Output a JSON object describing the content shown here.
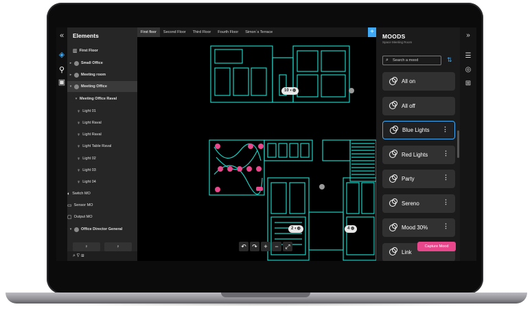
{
  "app": {
    "elements_title": "Elements",
    "collapse_left": "«",
    "collapse_right": "»",
    "floor_root": "First Floor"
  },
  "tree": [
    {
      "label": "Small Office",
      "kind": "room",
      "toggle": "▸"
    },
    {
      "label": "Meeting room",
      "kind": "room",
      "toggle": "▸"
    },
    {
      "label": "Meeting Office",
      "kind": "room",
      "toggle": "▾",
      "selected": true
    },
    {
      "label": "Meeting Office Raval",
      "kind": "group",
      "toggle": "▾"
    },
    {
      "label": "Light 01",
      "kind": "light"
    },
    {
      "label": "Light Raval",
      "kind": "light"
    },
    {
      "label": "Light Raval",
      "kind": "light"
    },
    {
      "label": "Light Table Raval",
      "kind": "light"
    },
    {
      "label": "Light 02",
      "kind": "light"
    },
    {
      "label": "Light 03",
      "kind": "light"
    },
    {
      "label": "Light 04",
      "kind": "light"
    },
    {
      "label": "Switch MO",
      "kind": "switch"
    },
    {
      "label": "Sensor MO",
      "kind": "sensor"
    },
    {
      "label": "Output MO",
      "kind": "output"
    },
    {
      "label": "Office Director General",
      "kind": "room",
      "toggle": "▾"
    }
  ],
  "tabs": [
    "First floor",
    "Second Floor",
    "Third Floor",
    "Fourth Floor",
    "Simon´s Terrace"
  ],
  "tab_add": "+",
  "map_pills": [
    {
      "label": "10"
    },
    {
      "label": "2"
    },
    {
      "label": "4"
    }
  ],
  "map_controls": [
    "↶",
    "↷",
    "+",
    "−",
    "⤢"
  ],
  "moods": {
    "title": "MOODS",
    "subtitle": "Space Meeting Room",
    "search_placeholder": "Search a mood",
    "items": [
      {
        "label": "All on",
        "menu": false
      },
      {
        "label": "All off",
        "menu": false
      },
      {
        "label": "Blue Lights",
        "menu": true,
        "selected": true
      },
      {
        "label": "Red Lights",
        "menu": true
      },
      {
        "label": "Party",
        "menu": true
      },
      {
        "label": "Sereno",
        "menu": true
      },
      {
        "label": "Mood 30%",
        "menu": true
      },
      {
        "label": "Link",
        "menu": false
      }
    ],
    "capture_label": "Capture Mood",
    "menu_glyph": "⋮"
  },
  "colors": {
    "accent": "#3fa9f5",
    "plan": "#19d3c5",
    "pink": "#e8478c"
  },
  "icons": {
    "left_rail": [
      "layers-icon",
      "nodes-icon",
      "calendar-icon"
    ],
    "right_rail": [
      "panel-icon",
      "mood-icon",
      "add-device-icon"
    ]
  }
}
